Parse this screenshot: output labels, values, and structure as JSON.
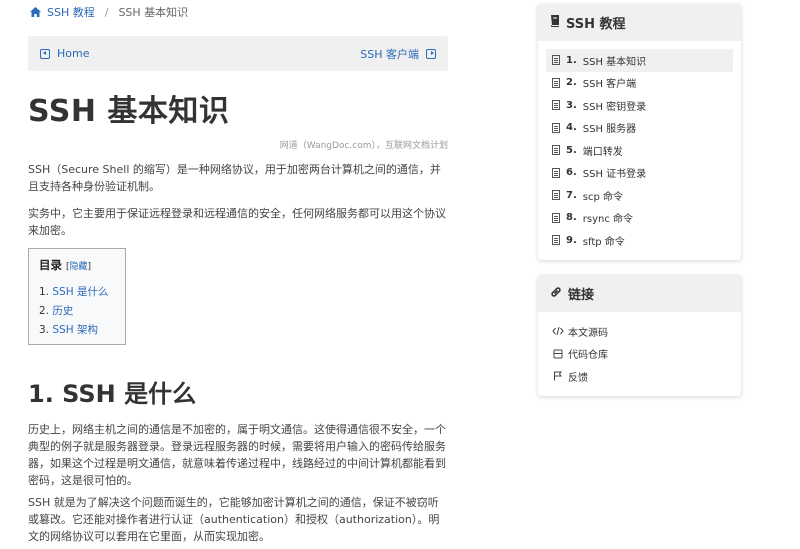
{
  "breadcrumb": {
    "home_label": "SSH 教程",
    "separator": "/",
    "current": "SSH 基本知识"
  },
  "pager": {
    "prev_label": "Home",
    "next_label": "SSH 客户端"
  },
  "article": {
    "title": "SSH 基本知识",
    "attribution": "网道（WangDoc.com），互联网文档计划",
    "intro_p1": "SSH（Secure Shell 的缩写）是一种网络协议，用于加密两台计算机之间的通信，并且支持各种身份验证机制。",
    "intro_p2": "实务中，它主要用于保证远程登录和远程通信的安全，任何网络服务都可以用这个协议来加密。",
    "section1_title": "1. SSH 是什么",
    "section1_p1": "历史上，网络主机之间的通信是不加密的，属于明文通信。这使得通信很不安全，一个典型的例子就是服务器登录。登录远程服务器的时候，需要将用户输入的密码传给服务器，如果这个过程是明文通信，就意味着传递过程中，线路经过的中间计算机都能看到密码，这是很可怕的。",
    "section1_p2": "SSH 就是为了解决这个问题而诞生的，它能够加密计算机之间的通信，保证不被窃听或篡改。它还能对操作者进行认证（authentication）和授权（authorization）。明文的网络协议可以套用在它里面，从而实现加密。"
  },
  "toc": {
    "heading": "目录",
    "toggle_open": "[",
    "toggle_label": "隐藏",
    "toggle_close": "]",
    "items": [
      {
        "num": "1.",
        "label": "SSH 是什么"
      },
      {
        "num": "2.",
        "label": "历史"
      },
      {
        "num": "3.",
        "label": "SSH 架构"
      }
    ]
  },
  "sidebar": {
    "tutorial_title": "SSH 教程",
    "chapters": [
      {
        "num": "1.",
        "label": "SSH 基本知识"
      },
      {
        "num": "2.",
        "label": "SSH 客户端"
      },
      {
        "num": "3.",
        "label": "SSH 密钥登录"
      },
      {
        "num": "4.",
        "label": "SSH 服务器"
      },
      {
        "num": "5.",
        "label": "端口转发"
      },
      {
        "num": "6.",
        "label": "SSH 证书登录"
      },
      {
        "num": "7.",
        "label": "scp 命令"
      },
      {
        "num": "8.",
        "label": "rsync 命令"
      },
      {
        "num": "9.",
        "label": "sftp 命令"
      }
    ],
    "links_title": "链接",
    "links": [
      {
        "label": "本文源码",
        "icon": "code-icon"
      },
      {
        "label": "代码仓库",
        "icon": "repo-icon"
      },
      {
        "label": "反馈",
        "icon": "flag-icon"
      }
    ]
  },
  "colors": {
    "link": "#2a6ab8",
    "panel_bg": "#f0f0f0"
  }
}
